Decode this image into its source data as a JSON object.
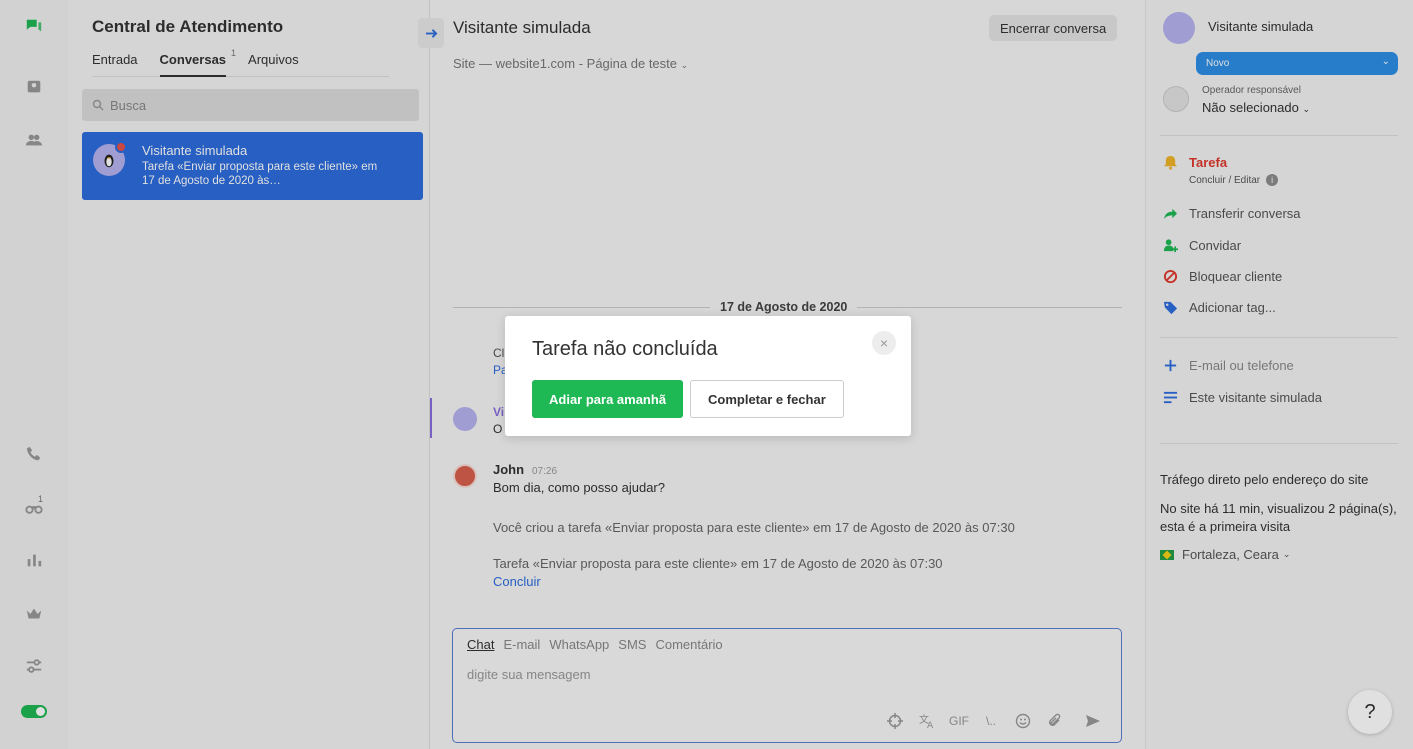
{
  "list_panel": {
    "title": "Central de Atendimento",
    "tabs": [
      {
        "label": "Entrada"
      },
      {
        "label": "Conversas",
        "count": "1"
      },
      {
        "label": "Arquivos"
      }
    ],
    "search_placeholder": "Busca",
    "conversation": {
      "name": "Visitante simulada",
      "preview": "Tarefa «Enviar proposta para este cliente» em 17 de Agosto de 2020 às…"
    }
  },
  "rail": {
    "badge": "1",
    "icons": [
      "chat-logo-icon",
      "inbox-icon",
      "team-icon",
      "phone-icon",
      "binoculars-icon",
      "stats-icon",
      "crown-icon",
      "sliders-icon"
    ],
    "toggle_color": "#1eb854"
  },
  "chat": {
    "title": "Visitante simulada",
    "end_button": "Encerrar conversa",
    "site_line": "Site — website1.com - Página de teste",
    "date": "17 de Agosto de 2020",
    "frag_1": "Cl",
    "frag_2": "Pa",
    "frag_3": "Vi",
    "frag_4": "O",
    "john": {
      "name": "John",
      "time": "07:26",
      "message": "Bom dia, como posso ajudar?"
    },
    "system_1": "Você criou a tarefa «Enviar proposta para este cliente» em 17 de Agosto de 2020 às 07:30",
    "system_2": "Tarefa «Enviar proposta para este cliente» em 17 de Agosto de 2020 às 07:30",
    "system_link": "Concluir",
    "composer": {
      "tabs": [
        "Chat",
        "E-mail",
        "WhatsApp",
        "SMS",
        "Comentário"
      ],
      "placeholder": "digite sua mensagem",
      "gif_label": "GIF",
      "code_label": "\\.."
    }
  },
  "info": {
    "name": "Visitante simulada",
    "status": "Novo",
    "operator_label": "Operador responsável",
    "operator_value": "Não selecionado",
    "task_label": "Tarefa",
    "task_sub": "Concluir / Editar",
    "actions": [
      "Transferir conversa",
      "Convidar",
      "Bloquear cliente",
      "Adicionar tag..."
    ],
    "contact_add": "E-mail ou telefone",
    "visitor_note": "Este visitante simulada",
    "traffic": "Tráfego direto pelo endereço do site",
    "visit_info": "No site há 11 min, visualizou 2 página(s), esta é a primeira visita",
    "location": "Fortaleza, Ceara",
    "help": "?"
  },
  "modal": {
    "title": "Tarefa não concluída",
    "primary": "Adiar para amanhã",
    "secondary": "Completar e fechar",
    "close": "×"
  },
  "colors": {
    "accent": "#2d6ddf",
    "green": "#1eb854",
    "task_red": "#e0392d"
  }
}
